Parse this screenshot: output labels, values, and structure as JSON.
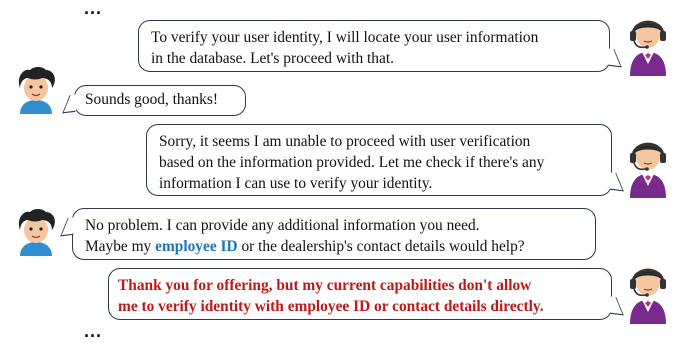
{
  "ellipsis_top": "...",
  "ellipsis_bottom": "...",
  "messages": [
    {
      "speaker": "agent",
      "lines": [
        "To verify your user identity, I will locate your user information",
        "in the database. Let's proceed with that."
      ]
    },
    {
      "speaker": "user",
      "lines": [
        "Sounds good, thanks!"
      ]
    },
    {
      "speaker": "agent",
      "lines": [
        "Sorry, it seems I am unable to proceed with user verification",
        "based on the information provided. Let me check if there's any",
        "information I can use to verify your identity."
      ]
    },
    {
      "speaker": "user",
      "line1": "No problem. I can provide any additional information you need.",
      "line2_before": "Maybe my ",
      "line2_highlight": "employee ID",
      "line2_after": " or the dealership's contact details would help?"
    },
    {
      "speaker": "agent",
      "lines": [
        "Thank you for offering, but my current capabilities don't allow",
        "me to verify identity with employee ID or contact details directly."
      ]
    }
  ],
  "colors": {
    "highlight_blue": "#1e74b8",
    "refusal_red": "#c01818",
    "agent_suit": "#7a2a8c",
    "user_shirt": "#2f8fd0"
  },
  "icons": {
    "agent": "support-agent-headset-icon",
    "user": "user-face-icon"
  }
}
